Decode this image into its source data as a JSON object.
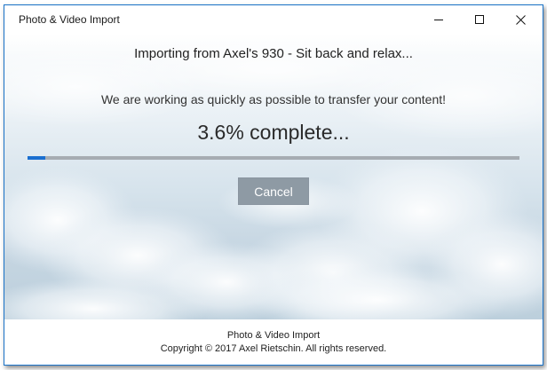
{
  "window": {
    "title": "Photo & Video Import"
  },
  "main": {
    "heading": "Importing from Axel's 930 - Sit back and relax...",
    "subheading": "We are working as quickly as possible to transfer your content!",
    "percent_text": "3.6% complete...",
    "progress_fraction": 0.036,
    "cancel_label": "Cancel"
  },
  "footer": {
    "app_name": "Photo & Video Import",
    "copyright": "Copyright © 2017 Axel Rietschin. All rights reserved."
  },
  "icons": {
    "minimize": "minimize-icon",
    "maximize": "maximize-icon",
    "close": "close-icon"
  },
  "colors": {
    "progress_fill": "#1a6fd0",
    "progress_track": "#a6acb2",
    "cancel_button": "#8e9aa4",
    "window_border": "#1a73c8"
  }
}
